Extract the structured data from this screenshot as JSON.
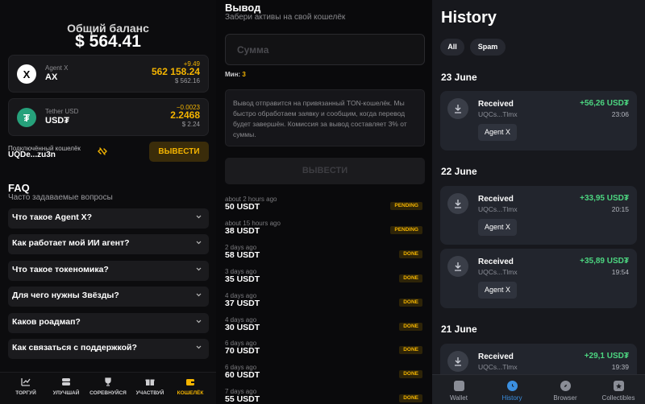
{
  "wallet": {
    "balance_title": "Общий баланс",
    "balance_value": "$ 564.41",
    "assets": [
      {
        "sub": "Agent X",
        "name": "AX",
        "icon": "x-logo-icon",
        "change": "+9.49",
        "amount": "562 158.24",
        "usd": "$ 562.16"
      },
      {
        "sub": "Tether USD",
        "name": "USD₮",
        "icon": "tether-icon",
        "change": "−0.0023",
        "amount": "2.2468",
        "usd": "$ 2.24"
      }
    ],
    "connected_label": "Подключённый кошелёк",
    "connected_address": "UQDe...zu3n",
    "withdraw_label": "ВЫВЕСТИ"
  },
  "faq": {
    "title": "FAQ",
    "subtitle": "Часто задаваемые вопросы",
    "items": [
      "Что такое Agent X?",
      "Как работает мой ИИ агент?",
      "Что такое токеномика?",
      "Для чего нужны Звёзды?",
      "Каков роадмап?",
      "Как связаться с поддержкой?"
    ]
  },
  "nav": {
    "tabs": [
      {
        "label": "ТОРГУЙ",
        "icon": "chart-icon"
      },
      {
        "label": "УЛУЧШАЙ",
        "icon": "layers-icon"
      },
      {
        "label": "СОРЕВНУЙСЯ",
        "icon": "trophy-icon"
      },
      {
        "label": "УЧАСТВУЙ",
        "icon": "gift-icon"
      },
      {
        "label": "КОШЕЛЁК",
        "icon": "wallet-icon",
        "active": true
      }
    ]
  },
  "withdraw": {
    "title": "Вывод",
    "subtitle": "Забери активы на свой кошелёк",
    "amount_placeholder": "Сумма",
    "min_label": "Мин:",
    "min_value": "3",
    "info": "Вывод отправится на привязанный TON-кошелёк. Мы быстро обработаем заявку и сообщим, когда перевод будет завершён. Комиссия за вывод составляет 3% от суммы.",
    "button_label": "ВЫВЕСТИ",
    "history": [
      {
        "time": "about 2 hours ago",
        "amount": "50 USDT",
        "status": "PENDING"
      },
      {
        "time": "about 15 hours ago",
        "amount": "38 USDT",
        "status": "PENDING"
      },
      {
        "time": "2 days ago",
        "amount": "58 USDT",
        "status": "DONE"
      },
      {
        "time": "3 days ago",
        "amount": "35 USDT",
        "status": "DONE"
      },
      {
        "time": "4 days ago",
        "amount": "37 USDT",
        "status": "DONE"
      },
      {
        "time": "4 days ago",
        "amount": "30 USDT",
        "status": "DONE"
      },
      {
        "time": "6 days ago",
        "amount": "70 USDT",
        "status": "DONE"
      },
      {
        "time": "6 days ago",
        "amount": "60 USDT",
        "status": "DONE"
      },
      {
        "time": "7 days ago",
        "amount": "55 USDT",
        "status": "DONE"
      }
    ]
  },
  "history": {
    "title": "History",
    "filters": [
      "All",
      "Spam"
    ],
    "groups": [
      {
        "date": "23 June",
        "items": [
          {
            "label": "Received",
            "address": "UQCs...Tlmx",
            "amount": "+56,26 USD₮",
            "time": "23:06",
            "tag": "Agent X"
          }
        ]
      },
      {
        "date": "22 June",
        "items": [
          {
            "label": "Received",
            "address": "UQCs...Tlmx",
            "amount": "+33,95 USD₮",
            "time": "20:15",
            "tag": "Agent X"
          },
          {
            "label": "Received",
            "address": "UQCs...Tlmx",
            "amount": "+35,89 USD₮",
            "time": "19:54",
            "tag": "Agent X"
          }
        ]
      },
      {
        "date": "21 June",
        "items": [
          {
            "label": "Received",
            "address": "UQCs...Tlmx",
            "amount": "+29,1 USD₮",
            "time": "19:39"
          }
        ]
      }
    ],
    "tabs": [
      {
        "label": "Wallet",
        "icon": "wallet-icon"
      },
      {
        "label": "History",
        "icon": "clock-icon",
        "active": true
      },
      {
        "label": "Browser",
        "icon": "compass-icon"
      },
      {
        "label": "Collectibles",
        "icon": "collectibles-icon"
      }
    ]
  },
  "colors": {
    "accent": "#f4b400",
    "positive": "#4cd580",
    "active_blue": "#3b8fe0"
  }
}
